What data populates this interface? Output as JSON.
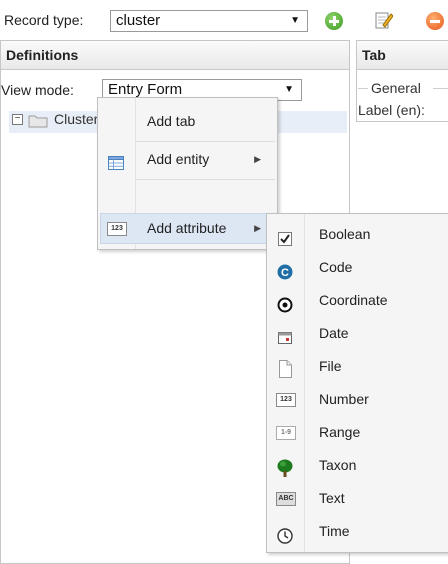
{
  "toolbar": {
    "record_type_label": "Record type:",
    "record_type_value": "cluster"
  },
  "definitions": {
    "header": "Definitions",
    "view_mode_label": "View mode:",
    "view_mode_value": "Entry Form",
    "tree": {
      "node_label": "Cluster"
    }
  },
  "tab_panel": {
    "header": "Tab",
    "fieldset_legend": "General",
    "label_en": "Label (en):"
  },
  "context_menu": {
    "items": [
      {
        "label": "Add tab"
      },
      {
        "label": "Add entity"
      },
      {
        "label": "Add attribute"
      }
    ]
  },
  "attribute_submenu": {
    "items": [
      {
        "label": "Boolean",
        "icon": "checkbox-icon"
      },
      {
        "label": "Code",
        "icon": "code-icon"
      },
      {
        "label": "Coordinate",
        "icon": "coordinate-icon"
      },
      {
        "label": "Date",
        "icon": "calendar-icon"
      },
      {
        "label": "File",
        "icon": "file-icon"
      },
      {
        "label": "Number",
        "icon": "number-icon"
      },
      {
        "label": "Range",
        "icon": "range-icon"
      },
      {
        "label": "Taxon",
        "icon": "tree-icon"
      },
      {
        "label": "Text",
        "icon": "text-icon"
      },
      {
        "label": "Time",
        "icon": "clock-icon"
      }
    ]
  }
}
